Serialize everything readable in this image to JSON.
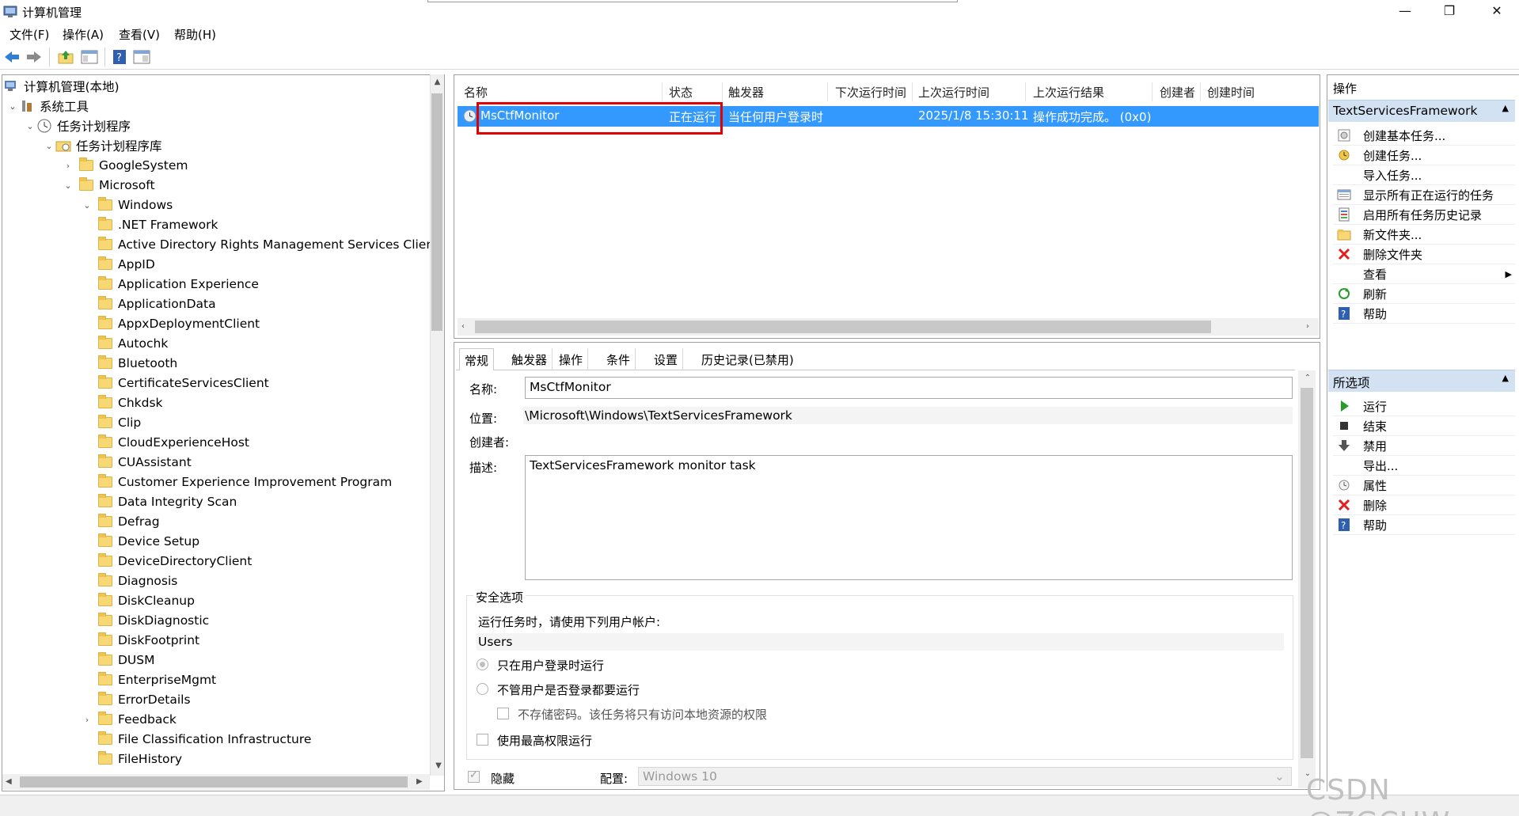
{
  "window": {
    "title": "计算机管理",
    "minimize": "—",
    "maximize": "❐",
    "close": "✕"
  },
  "menu": [
    "文件(F)",
    "操作(A)",
    "查看(V)",
    "帮助(H)"
  ],
  "tree": {
    "root": "计算机管理(本地)",
    "system_tools": "系统工具",
    "task_scheduler": "任务计划程序",
    "task_library": "任务计划程序库",
    "google": "GoogleSystem",
    "microsoft": "Microsoft",
    "windows": "Windows",
    "folders": [
      ".NET Framework",
      "Active Directory Rights Management Services Clien",
      "AppID",
      "Application Experience",
      "ApplicationData",
      "AppxDeploymentClient",
      "Autochk",
      "Bluetooth",
      "CertificateServicesClient",
      "Chkdsk",
      "Clip",
      "CloudExperienceHost",
      "CUAssistant",
      "Customer Experience Improvement Program",
      "Data Integrity Scan",
      "Defrag",
      "Device Setup",
      "DeviceDirectoryClient",
      "Diagnosis",
      "DiskCleanup",
      "DiskDiagnostic",
      "DiskFootprint",
      "DUSM",
      "EnterpriseMgmt",
      "ErrorDetails",
      "Feedback",
      "File Classification Infrastructure",
      "FileHistory"
    ]
  },
  "task_list": {
    "columns": [
      "名称",
      "状态",
      "触发器",
      "下次运行时间",
      "上次运行时间",
      "上次运行结果",
      "创建者",
      "创建时间"
    ],
    "rows": [
      {
        "name": "MsCtfMonitor",
        "status": "正在运行",
        "trigger": "当任何用户登录时",
        "next_run": "",
        "last_run": "2025/1/8 15:30:11",
        "last_result": "操作成功完成。 (0x0)",
        "author": "",
        "created": ""
      }
    ]
  },
  "details": {
    "tabs": [
      "常规",
      "触发器",
      "操作",
      "条件",
      "设置",
      "历史记录(已禁用)"
    ],
    "name_label": "名称:",
    "name_value": "MsCtfMonitor",
    "location_label": "位置:",
    "location_value": "\\Microsoft\\Windows\\TextServicesFramework",
    "author_label": "创建者:",
    "description_label": "描述:",
    "description_value": "TextServicesFramework monitor task",
    "security_title": "安全选项",
    "run_as_prompt": "运行任务时，请使用下列用户帐户:",
    "user_account": "Users",
    "radio_logged_on": "只在用户登录时运行",
    "radio_whether": "不管用户是否登录都要运行",
    "no_store_password": "不存储密码。该任务将只有访问本地资源的权限",
    "highest_privileges": "使用最高权限运行",
    "hidden_label": "隐藏",
    "config_label": "配置:",
    "config_value": "Windows 10"
  },
  "actions": {
    "header": "操作",
    "section1": "TextServicesFramework",
    "section1_items": [
      {
        "label": "创建基本任务...",
        "icon": "wizard-icon"
      },
      {
        "label": "创建任务...",
        "icon": "create-task-icon"
      },
      {
        "label": "导入任务...",
        "icon": ""
      },
      {
        "label": "显示所有正在运行的任务",
        "icon": "running-tasks-icon"
      },
      {
        "label": "启用所有任务历史记录",
        "icon": "history-icon"
      },
      {
        "label": "新文件夹...",
        "icon": "folder-icon"
      },
      {
        "label": "删除文件夹",
        "icon": "delete-icon"
      },
      {
        "label": "查看",
        "icon": ""
      },
      {
        "label": "刷新",
        "icon": "refresh-icon"
      },
      {
        "label": "帮助",
        "icon": "help-icon"
      }
    ],
    "section2": "所选项",
    "section2_items": [
      {
        "label": "运行",
        "icon": "run-icon"
      },
      {
        "label": "结束",
        "icon": "stop-icon"
      },
      {
        "label": "禁用",
        "icon": "disable-icon"
      },
      {
        "label": "导出...",
        "icon": ""
      },
      {
        "label": "属性",
        "icon": "properties-icon"
      },
      {
        "label": "删除",
        "icon": "delete-icon"
      },
      {
        "label": "帮助",
        "icon": "help-icon"
      }
    ]
  },
  "watermark": "CSDN @ZGCHW",
  "colors": {
    "selection": "#3399ff",
    "highlight_box": "#e00000",
    "action_section": "#d3e2f3"
  }
}
